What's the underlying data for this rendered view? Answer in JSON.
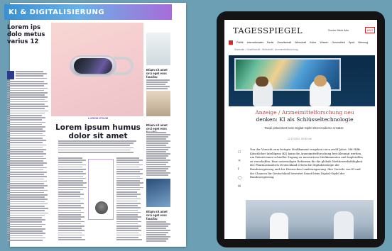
{
  "print": {
    "banner": "KI & DIGITALISIERUNG",
    "left_title": "Lorem ips dolo metus varius 12",
    "hero_kicker": "LOREM IPSUM",
    "hero_title": "Lorem ipsum humus dolor sit amet",
    "side_head_1": "Etiam sit amet orci eget eros faucibu",
    "side_head_2": "Etiam sit amet orci eget eros faucibu",
    "side_head_3": "Etiam sit amet orci eget eros faucibu"
  },
  "web": {
    "logo": "TAGESSPIEGEL",
    "topics": "Suche   Mein Abo",
    "abo": "ABO",
    "nav": [
      "Politik",
      "Internationales",
      "Berlin",
      "Gesellschaft",
      "Wirtschaft",
      "Kultur",
      "Wissen",
      "Gesundheit",
      "Sport",
      "Meinung"
    ],
    "breadcrumb": "Startseite  ›  Gesellschaft  ›  Wirtschaft  ›  Arzneimittelforschung",
    "kicker": "Anzeige / Arzneimittelforschung neu",
    "headline": "denken: KI als Schlüsseltechnologie",
    "subline": "Tanali präsentiert beim Digital-Gipfel 2024 moderne Ansätze",
    "date": "12.10.2024, 09:00 Uhr",
    "body": "Von der Vorsicht zum fertigen Medikament vergehen circa zwölf Jahre. Mit Hilfe Künstlicher Intelligenz (KI) kann die Arzneimittelforschung beschleunigt werden, um Patient:innen schneller Zugang zu innovativen Medikamenten und Impfstoffen zu verschaffen. Eine notwendigen Reformen für die globale Wettbewerbsfähigkeit des Pharmastandorts Deutschland setzen die Digitalstrategie der Bundesregierung und der Hessischen Landesregierung. Ihre Vorteile von KI und die Chancen für Deutschland bewertet Sanofi beim Digital-Gipfel der Bundesregierung."
  }
}
